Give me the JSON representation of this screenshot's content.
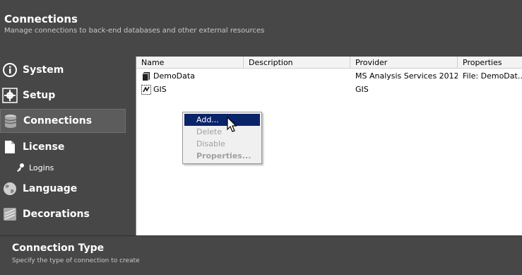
{
  "header": {
    "title": "Connections",
    "subtitle": "Manage connections to back-end databases and other external resources"
  },
  "sidebar": {
    "items": [
      {
        "label": "System",
        "icon": "info-icon"
      },
      {
        "label": "Setup",
        "icon": "gear-icon"
      },
      {
        "label": "Connections",
        "icon": "database-icon"
      },
      {
        "label": "License",
        "icon": "document-icon"
      },
      {
        "label": "Logins",
        "icon": "user-key-icon"
      },
      {
        "label": "Language",
        "icon": "globe-icon"
      },
      {
        "label": "Decorations",
        "icon": "decorations-icon"
      }
    ],
    "active_index": 2
  },
  "table": {
    "columns": [
      "Name",
      "Description",
      "Provider",
      "Properties"
    ],
    "rows": [
      {
        "name": "DemoData",
        "description": "",
        "provider": "MS Analysis Services 2012",
        "properties": "File: DemoDat...",
        "icon": "cube-icon"
      },
      {
        "name": "GIS",
        "description": "",
        "provider": "GIS",
        "properties": "",
        "icon": "gis-icon"
      }
    ]
  },
  "context_menu": {
    "items": [
      {
        "label": "Add...",
        "enabled": true,
        "highlighted": true
      },
      {
        "label": "Delete",
        "enabled": false
      },
      {
        "label": "Disable",
        "enabled": false
      },
      {
        "label": "Properties...",
        "enabled": false,
        "bold": true
      }
    ]
  },
  "footer": {
    "title": "Connection Type",
    "subtitle": "Specify the type of connection to create"
  },
  "colors": {
    "chrome_bg": "#474747",
    "highlight": "#0a246a",
    "panel_bg": "#ffffff"
  }
}
